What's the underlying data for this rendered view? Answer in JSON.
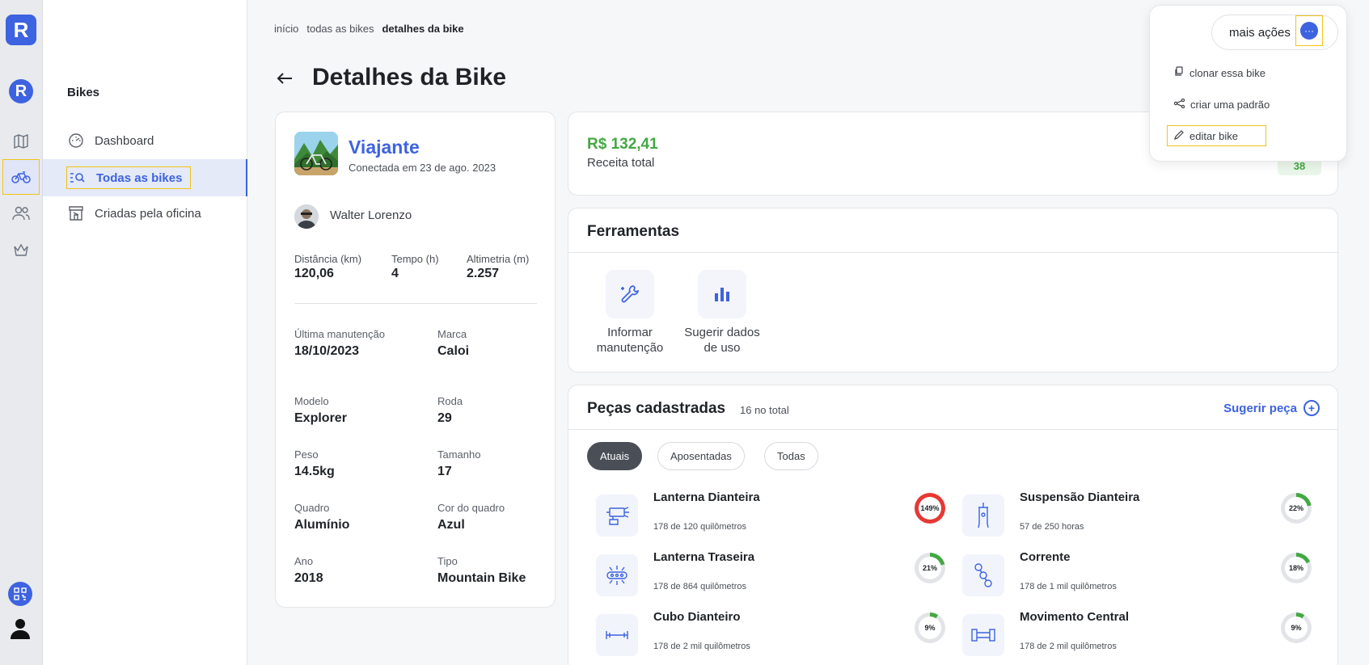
{
  "rail": {
    "logo": "R",
    "org_logo": "R"
  },
  "sidebar": {
    "title": "Bikes",
    "items": [
      {
        "label": "Dashboard"
      },
      {
        "label": "Todas as bikes"
      },
      {
        "label": "Criadas pela oficina"
      }
    ]
  },
  "breadcrumb": [
    "início",
    "todas as bikes",
    "detalhes da bike"
  ],
  "page_title": "Detalhes da Bike",
  "bike": {
    "name": "Viajante",
    "connected": "Conectada em 23 de ago. 2023",
    "owner": "Walter Lorenzo",
    "stats": [
      {
        "label": "Distância (km)",
        "value": "120,06"
      },
      {
        "label": "Tempo (h)",
        "value": "4"
      },
      {
        "label": "Altimetria (m)",
        "value": "2.257"
      }
    ],
    "specs": [
      {
        "label": "Última manutenção",
        "value": "18/10/2023"
      },
      {
        "label": "Marca",
        "value": "Caloi"
      },
      {
        "label": "Modelo",
        "value": "Explorer"
      },
      {
        "label": "Roda",
        "value": "29"
      },
      {
        "label": "Peso",
        "value": "14.5kg"
      },
      {
        "label": "Tamanho",
        "value": "17"
      },
      {
        "label": "Quadro",
        "value": "Alumínio"
      },
      {
        "label": "Cor do quadro",
        "value": "Azul"
      },
      {
        "label": "Ano",
        "value": "2018"
      },
      {
        "label": "Tipo",
        "value": "Mountain Bike"
      }
    ]
  },
  "revenue": {
    "value": "R$ 132,41",
    "label": "Receita total",
    "badge": "38"
  },
  "tools": {
    "title": "Ferramentas",
    "items": [
      {
        "label": "Informar manutenção",
        "icon": "wrench-icon"
      },
      {
        "label": "Sugerir dados de uso",
        "icon": "bar-chart-icon"
      }
    ]
  },
  "parts": {
    "title": "Peças cadastradas",
    "count": "16 no total",
    "suggest_label": "Sugerir peça",
    "filters": [
      "Atuais",
      "Aposentadas",
      "Todas"
    ],
    "active_filter": "Atuais",
    "items": [
      {
        "name": "Lanterna Dianteira",
        "usage": "178 de 120 quilômetros",
        "percent_label": "149%",
        "percent": 149,
        "icon": "headlight-icon"
      },
      {
        "name": "Suspensão Dianteira",
        "usage": "57 de 250 horas",
        "percent_label": "22%",
        "percent": 22,
        "icon": "fork-icon"
      },
      {
        "name": "Lanterna Traseira",
        "usage": "178 de 864 quilômetros",
        "percent_label": "21%",
        "percent": 21,
        "icon": "taillight-icon"
      },
      {
        "name": "Corrente",
        "usage": "178 de 1 mil quilômetros",
        "percent_label": "18%",
        "percent": 18,
        "icon": "chain-icon"
      },
      {
        "name": "Cubo Dianteiro",
        "usage": "178 de 2 mil quilômetros",
        "percent_label": "9%",
        "percent": 9,
        "icon": "hub-icon"
      },
      {
        "name": "Movimento Central",
        "usage": "178 de 2 mil quilômetros",
        "percent_label": "9%",
        "percent": 9,
        "icon": "bottom-bracket-icon"
      }
    ]
  },
  "menu": {
    "trigger_label": "mais ações",
    "trigger_icon": "···",
    "items": [
      {
        "label": "clonar essa bike",
        "icon": "copy-icon"
      },
      {
        "label": "criar uma padrão",
        "icon": "share-icon"
      },
      {
        "label": "editar bike",
        "icon": "pencil-icon"
      }
    ]
  },
  "colors": {
    "accent": "#3d63e0",
    "success": "#43a843",
    "danger": "#e53935",
    "highlight": "#f0c419"
  }
}
